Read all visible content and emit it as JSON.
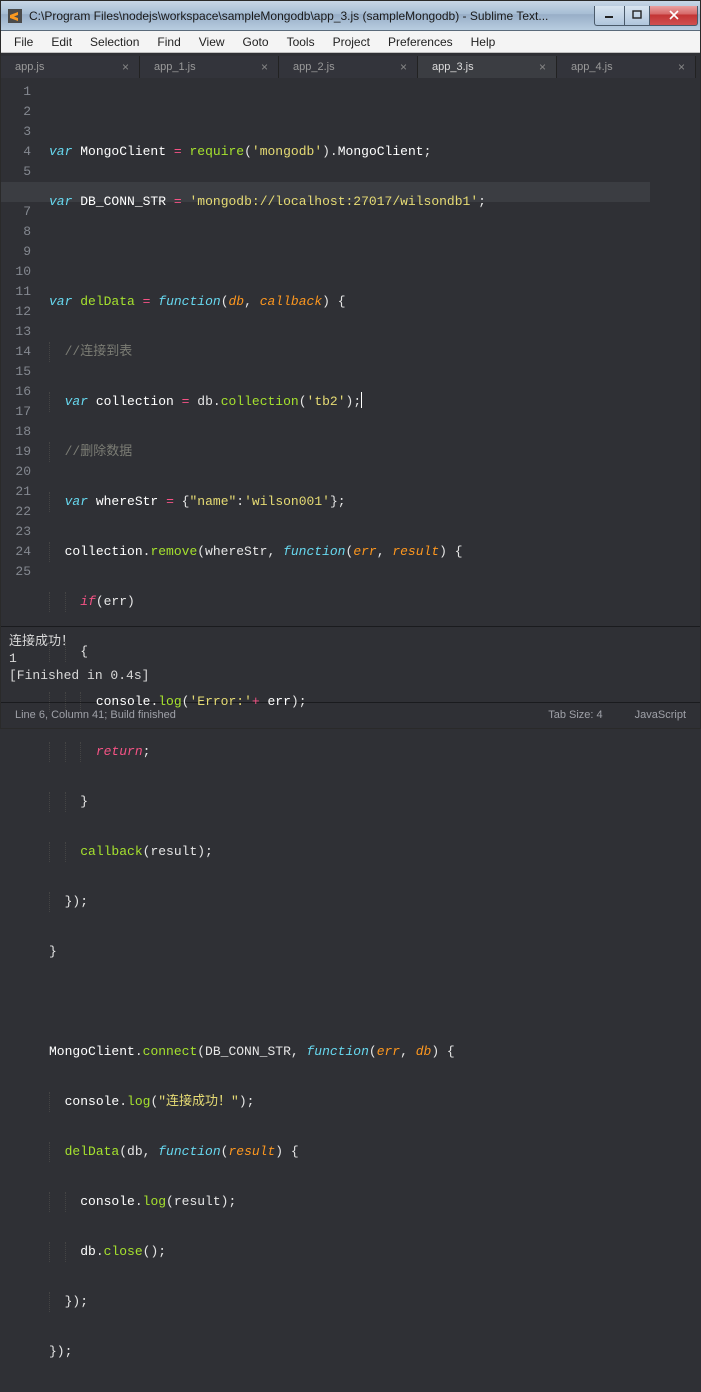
{
  "window": {
    "title": "C:\\Program Files\\nodejs\\workspace\\sampleMongodb\\app_3.js (sampleMongodb) - Sublime Text..."
  },
  "menu": {
    "items": [
      "File",
      "Edit",
      "Selection",
      "Find",
      "View",
      "Goto",
      "Tools",
      "Project",
      "Preferences",
      "Help"
    ]
  },
  "tabs": {
    "items": [
      {
        "label": "app.js",
        "active": false
      },
      {
        "label": "app_1.js",
        "active": false
      },
      {
        "label": "app_2.js",
        "active": false
      },
      {
        "label": "app_3.js",
        "active": true
      },
      {
        "label": "app_4.js",
        "active": false
      }
    ],
    "close_glyph": "×"
  },
  "code": {
    "require_fn": "require",
    "mongodb_mod": "'mongodb'",
    "mongoclient_prop": "MongoClient",
    "dbconn_name": "DB_CONN_STR",
    "conn_str": "'mongodb://localhost:27017/wilsondb1'",
    "deldata_name": "delData",
    "function_kw": "function",
    "db_arg": "db",
    "callback_arg": "callback",
    "comment_conn_table": "//连接到表",
    "collection_var": "collection",
    "collection_fn": "collection",
    "tb2": "'tb2'",
    "comment_del": "//删除数据",
    "wherestr_name": "whereStr",
    "name_key": "\"name\"",
    "wilson_val": "'wilson001'",
    "remove_fn": "remove",
    "err_arg": "err",
    "result_arg": "result",
    "if_kw": "if",
    "console_obj": "console",
    "log_fn": "log",
    "error_str": "'Error:'",
    "plus": "+ ",
    "return_kw": "return",
    "connect_fn": "connect",
    "success_str": "\"连接成功！\"",
    "close_fn": "close",
    "var_kw": "var"
  },
  "console": {
    "line1": "连接成功！",
    "line2": "1",
    "line3": "[Finished in 0.4s]"
  },
  "status": {
    "left": "Line 6, Column 41; Build finished",
    "tab_size": "Tab Size: 4",
    "syntax": "JavaScript"
  },
  "icons": {
    "minimize": "minimize-icon",
    "maximize": "maximize-icon",
    "close": "close-icon",
    "sublime": "sublime-icon"
  }
}
